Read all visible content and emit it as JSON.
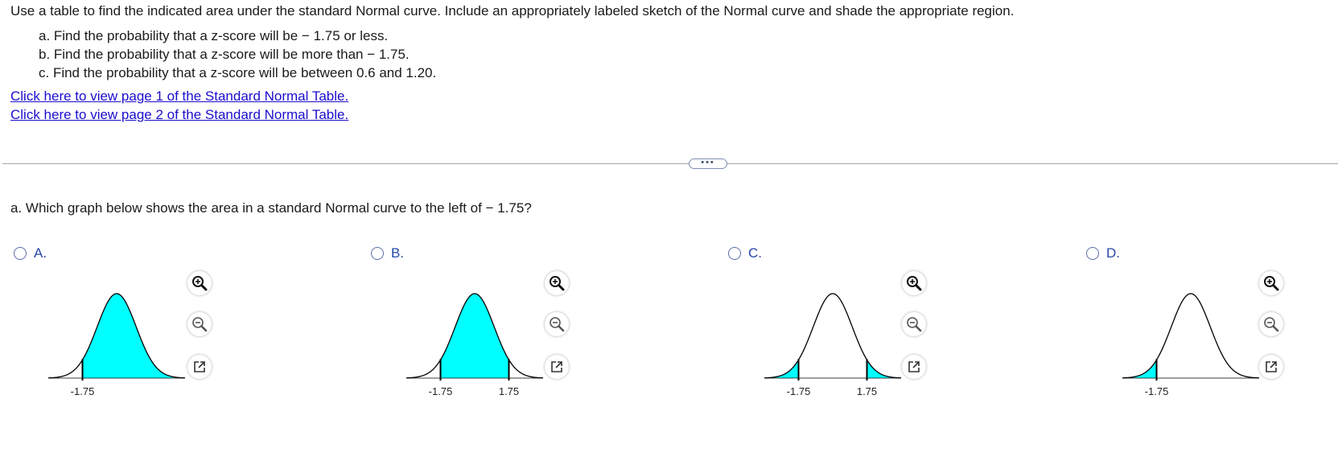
{
  "prompt": "Use a table to find the indicated area under the standard Normal curve. Include an appropriately labeled sketch of the Normal curve and shade the appropriate region.",
  "parts": [
    "a. Find the probability that a z-score will be − 1.75 or less.",
    "b. Find the probability that a z-score will be more than − 1.75.",
    "c. Find the probability that a z-score will be between 0.6 and 1.20."
  ],
  "links": [
    "Click here to view page 1 of the Standard Normal Table.",
    "Click here to view page 2 of the Standard Normal Table."
  ],
  "more_label": "•••",
  "question": "a. Which graph below shows the area in a standard Normal curve to the left of − 1.75?",
  "shade_color": "#00ffff",
  "link_color": "#1a0dcc",
  "options": [
    {
      "letter": "A.",
      "shaded": "middle-right",
      "ticks": [
        "-1.75"
      ]
    },
    {
      "letter": "B.",
      "shaded": "between",
      "ticks": [
        "-1.75",
        "1.75"
      ]
    },
    {
      "letter": "C.",
      "shaded": "tails",
      "ticks": [
        "-1.75",
        "1.75"
      ]
    },
    {
      "letter": "D.",
      "shaded": "left-tail",
      "ticks": [
        "-1.75"
      ]
    }
  ],
  "tools": [
    "zoom-in-icon",
    "zoom-out-icon",
    "pop-out-icon"
  ]
}
